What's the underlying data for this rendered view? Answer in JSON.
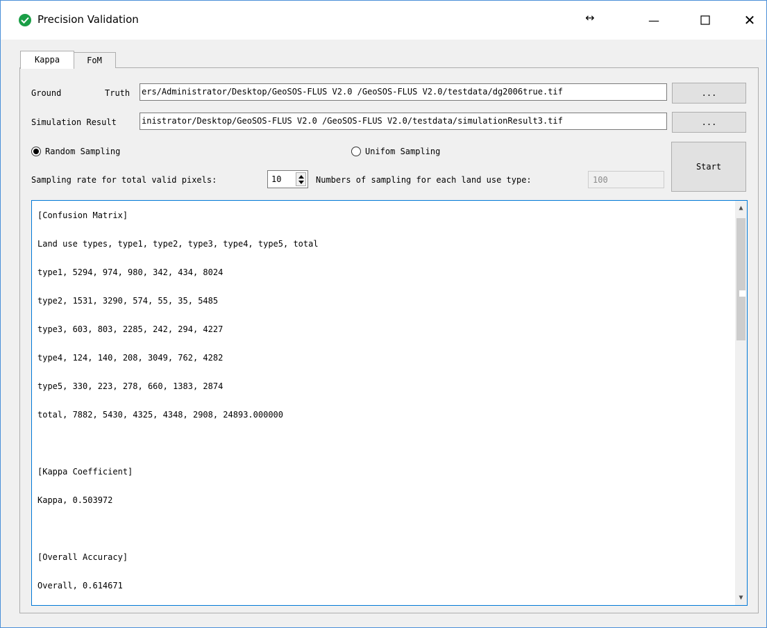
{
  "window": {
    "title": "Precision Validation",
    "resize_glyph": "↔",
    "minimize_glyph": "—",
    "maximize_glyph": "☐",
    "close_glyph": "✕",
    "icon": "check-circle-icon",
    "accent": "#1a9e46"
  },
  "tabs": [
    {
      "label": "Kappa",
      "active": true
    },
    {
      "label": "FoM",
      "active": false
    }
  ],
  "form": {
    "ground_label": "Ground",
    "truth_label": "Truth",
    "ground_truth_value": "ers/Administrator/Desktop/GeoSOS-FLUS V2.0 /GeoSOS-FLUS V2.0/testdata/dg2006true.tif",
    "browse_label": "...",
    "simulation_label": "Simulation Result",
    "simulation_value": "inistrator/Desktop/GeoSOS-FLUS V2.0 /GeoSOS-FLUS V2.0/testdata/simulationResult3.tif",
    "random_sampling_label": "Random Sampling",
    "random_sampling_checked": true,
    "uniform_sampling_label": "Unifom Sampling",
    "uniform_sampling_checked": false,
    "start_label": "Start",
    "sampling_rate_label": "Sampling rate for total valid pixels:",
    "sampling_rate_value": "10",
    "numbers_label": "Numbers of sampling for each land use type:",
    "numbers_value": "100"
  },
  "output": {
    "lines": [
      "[Confusion Matrix]",
      "Land use types, type1, type2, type3, type4, type5, total",
      "type1, 5294, 974, 980, 342, 434, 8024",
      "type2, 1531, 3290, 574, 55, 35, 5485",
      "type3, 603, 803, 2285, 242, 294, 4227",
      "type4, 124, 140, 208, 3049, 762, 4282",
      "type5, 330, 223, 278, 660, 1383, 2874",
      "total, 7882, 5430, 4325, 4348, 2908, 24893.000000",
      "",
      "[Kappa Coefficient]",
      "Kappa, 0.503972",
      "",
      "[Overall Accuracy]",
      "Overall, 0.614671"
    ]
  }
}
